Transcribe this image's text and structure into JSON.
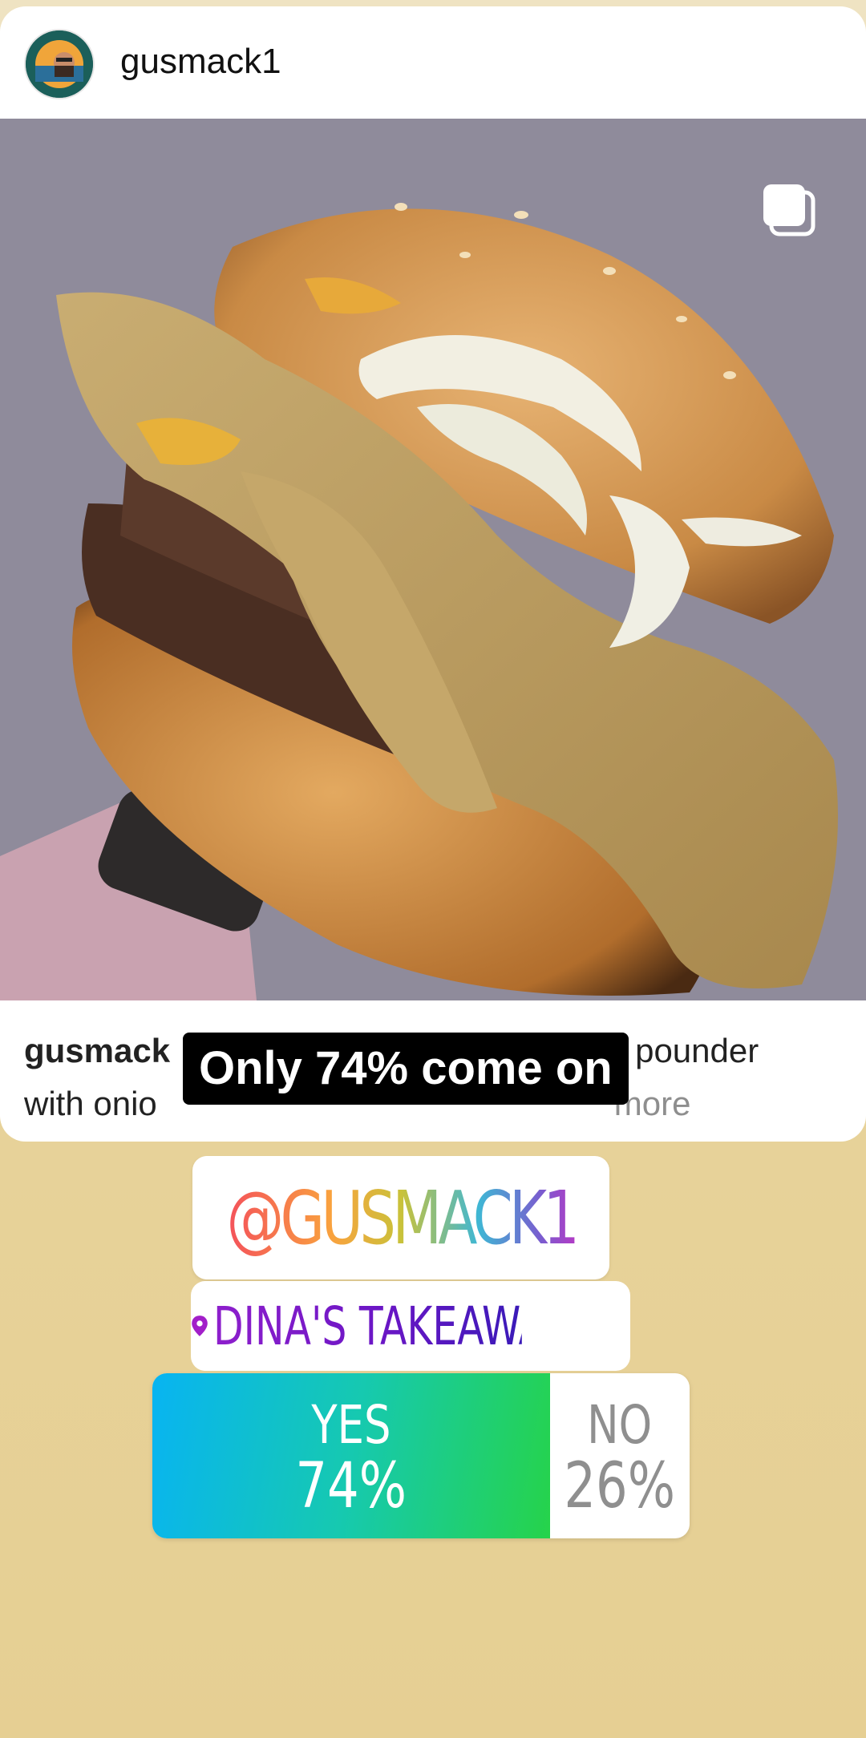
{
  "post": {
    "username": "gusmack1",
    "avatar_icon": "foodie-gusmack1-avatar",
    "carousel_icon": "multiple-images-icon",
    "caption": {
      "user": "gusmack",
      "line1_end": "pounder",
      "line2_start": "with onio",
      "more": "more"
    }
  },
  "overlay_text": "Only 74% come on",
  "stickers": {
    "mention": "@GUSMACK1",
    "location": "DINA'S TAKEAWAY",
    "location_icon": "location-pin-icon"
  },
  "poll": {
    "yes_label": "YES",
    "yes_pct": "74%",
    "yes_fraction": 0.74,
    "no_label": "NO",
    "no_pct": "26%",
    "no_fraction": 0.26
  },
  "colors": {
    "background": "#e8d49d",
    "poll_gradient_start": "#08b4f2",
    "poll_gradient_end": "#26d34a",
    "location_text": "#7a1cc8"
  }
}
